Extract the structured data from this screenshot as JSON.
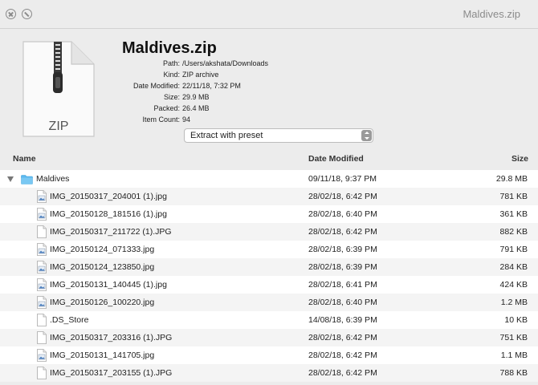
{
  "window": {
    "title": "Maldives.zip"
  },
  "archive": {
    "name": "Maldives.zip",
    "icon_label": "ZIP",
    "details": [
      {
        "label": "Path:",
        "value": "/Users/akshata/Downloads"
      },
      {
        "label": "Kind:",
        "value": "ZIP archive"
      },
      {
        "label": "Date Modified:",
        "value": "22/11/18, 7:32 PM"
      },
      {
        "label": "Size:",
        "value": "29.9 MB"
      },
      {
        "label": "Packed:",
        "value": "26.4 MB"
      },
      {
        "label": "Item Count:",
        "value": "94"
      }
    ]
  },
  "preset": {
    "selected": "Extract with preset"
  },
  "columns": {
    "name": "Name",
    "date": "Date Modified",
    "size": "Size"
  },
  "rows": [
    {
      "name": "Maldives",
      "date": "09/11/18, 9:37 PM",
      "size": "29.8 MB",
      "kind": "folder"
    },
    {
      "name": "IMG_20150317_204001 (1).jpg",
      "date": "28/02/18, 6:42 PM",
      "size": "781 KB",
      "kind": "image"
    },
    {
      "name": "IMG_20150128_181516 (1).jpg",
      "date": "28/02/18, 6:40 PM",
      "size": "361 KB",
      "kind": "image"
    },
    {
      "name": "IMG_20150317_211722 (1).JPG",
      "date": "28/02/18, 6:42 PM",
      "size": "882 KB",
      "kind": "doc"
    },
    {
      "name": "IMG_20150124_071333.jpg",
      "date": "28/02/18, 6:39 PM",
      "size": "791 KB",
      "kind": "image"
    },
    {
      "name": "IMG_20150124_123850.jpg",
      "date": "28/02/18, 6:39 PM",
      "size": "284 KB",
      "kind": "image"
    },
    {
      "name": "IMG_20150131_140445 (1).jpg",
      "date": "28/02/18, 6:41 PM",
      "size": "424 KB",
      "kind": "image"
    },
    {
      "name": "IMG_20150126_100220.jpg",
      "date": "28/02/18, 6:40 PM",
      "size": "1.2 MB",
      "kind": "image"
    },
    {
      "name": ".DS_Store",
      "date": "14/08/18, 6:39 PM",
      "size": "10 KB",
      "kind": "doc"
    },
    {
      "name": "IMG_20150317_203316 (1).JPG",
      "date": "28/02/18, 6:42 PM",
      "size": "751 KB",
      "kind": "doc"
    },
    {
      "name": "IMG_20150131_141705.jpg",
      "date": "28/02/18, 6:42 PM",
      "size": "1.1 MB",
      "kind": "image"
    },
    {
      "name": "IMG_20150317_203155 (1).JPG",
      "date": "28/02/18, 6:42 PM",
      "size": "788 KB",
      "kind": "doc"
    }
  ],
  "colors": {
    "folder": "#5cb9ef",
    "window_bg": "#ececec",
    "row_alt": "#f4f4f4"
  }
}
